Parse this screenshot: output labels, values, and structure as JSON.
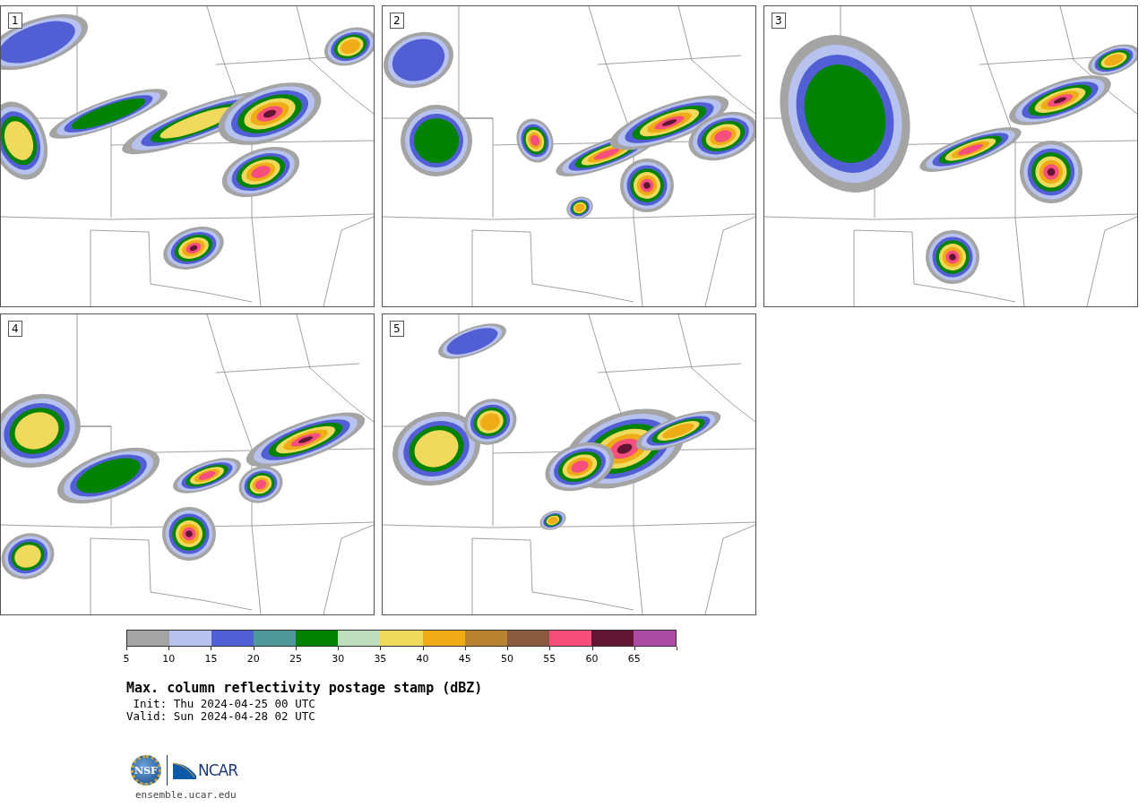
{
  "panels": [
    {
      "label": "1"
    },
    {
      "label": "2"
    },
    {
      "label": "3"
    },
    {
      "label": "4"
    },
    {
      "label": "5"
    }
  ],
  "colorbar": {
    "segments": [
      {
        "color": "#a4a4a4"
      },
      {
        "color": "#b8c2ee"
      },
      {
        "color": "#525fd4"
      },
      {
        "color": "#4e979b"
      },
      {
        "color": "#018301"
      },
      {
        "color": "#bedfbe"
      },
      {
        "color": "#f0da5c"
      },
      {
        "color": "#f0ac16"
      },
      {
        "color": "#b98231"
      },
      {
        "color": "#8a5a3e"
      },
      {
        "color": "#f64f7d"
      },
      {
        "color": "#621633"
      },
      {
        "color": "#ad4aa4"
      }
    ],
    "ticks": [
      "5",
      "10",
      "15",
      "20",
      "25",
      "30",
      "35",
      "40",
      "45",
      "50",
      "55",
      "60",
      "65"
    ]
  },
  "title": "Max. column reflectivity postage stamp (dBZ)",
  "init": " Init: Thu 2024-04-25 00 UTC",
  "valid": "Valid: Sun 2024-04-28 02 UTC",
  "logo": {
    "left": "NSF",
    "right": "NCAR"
  },
  "url": "ensemble.ucar.edu"
}
